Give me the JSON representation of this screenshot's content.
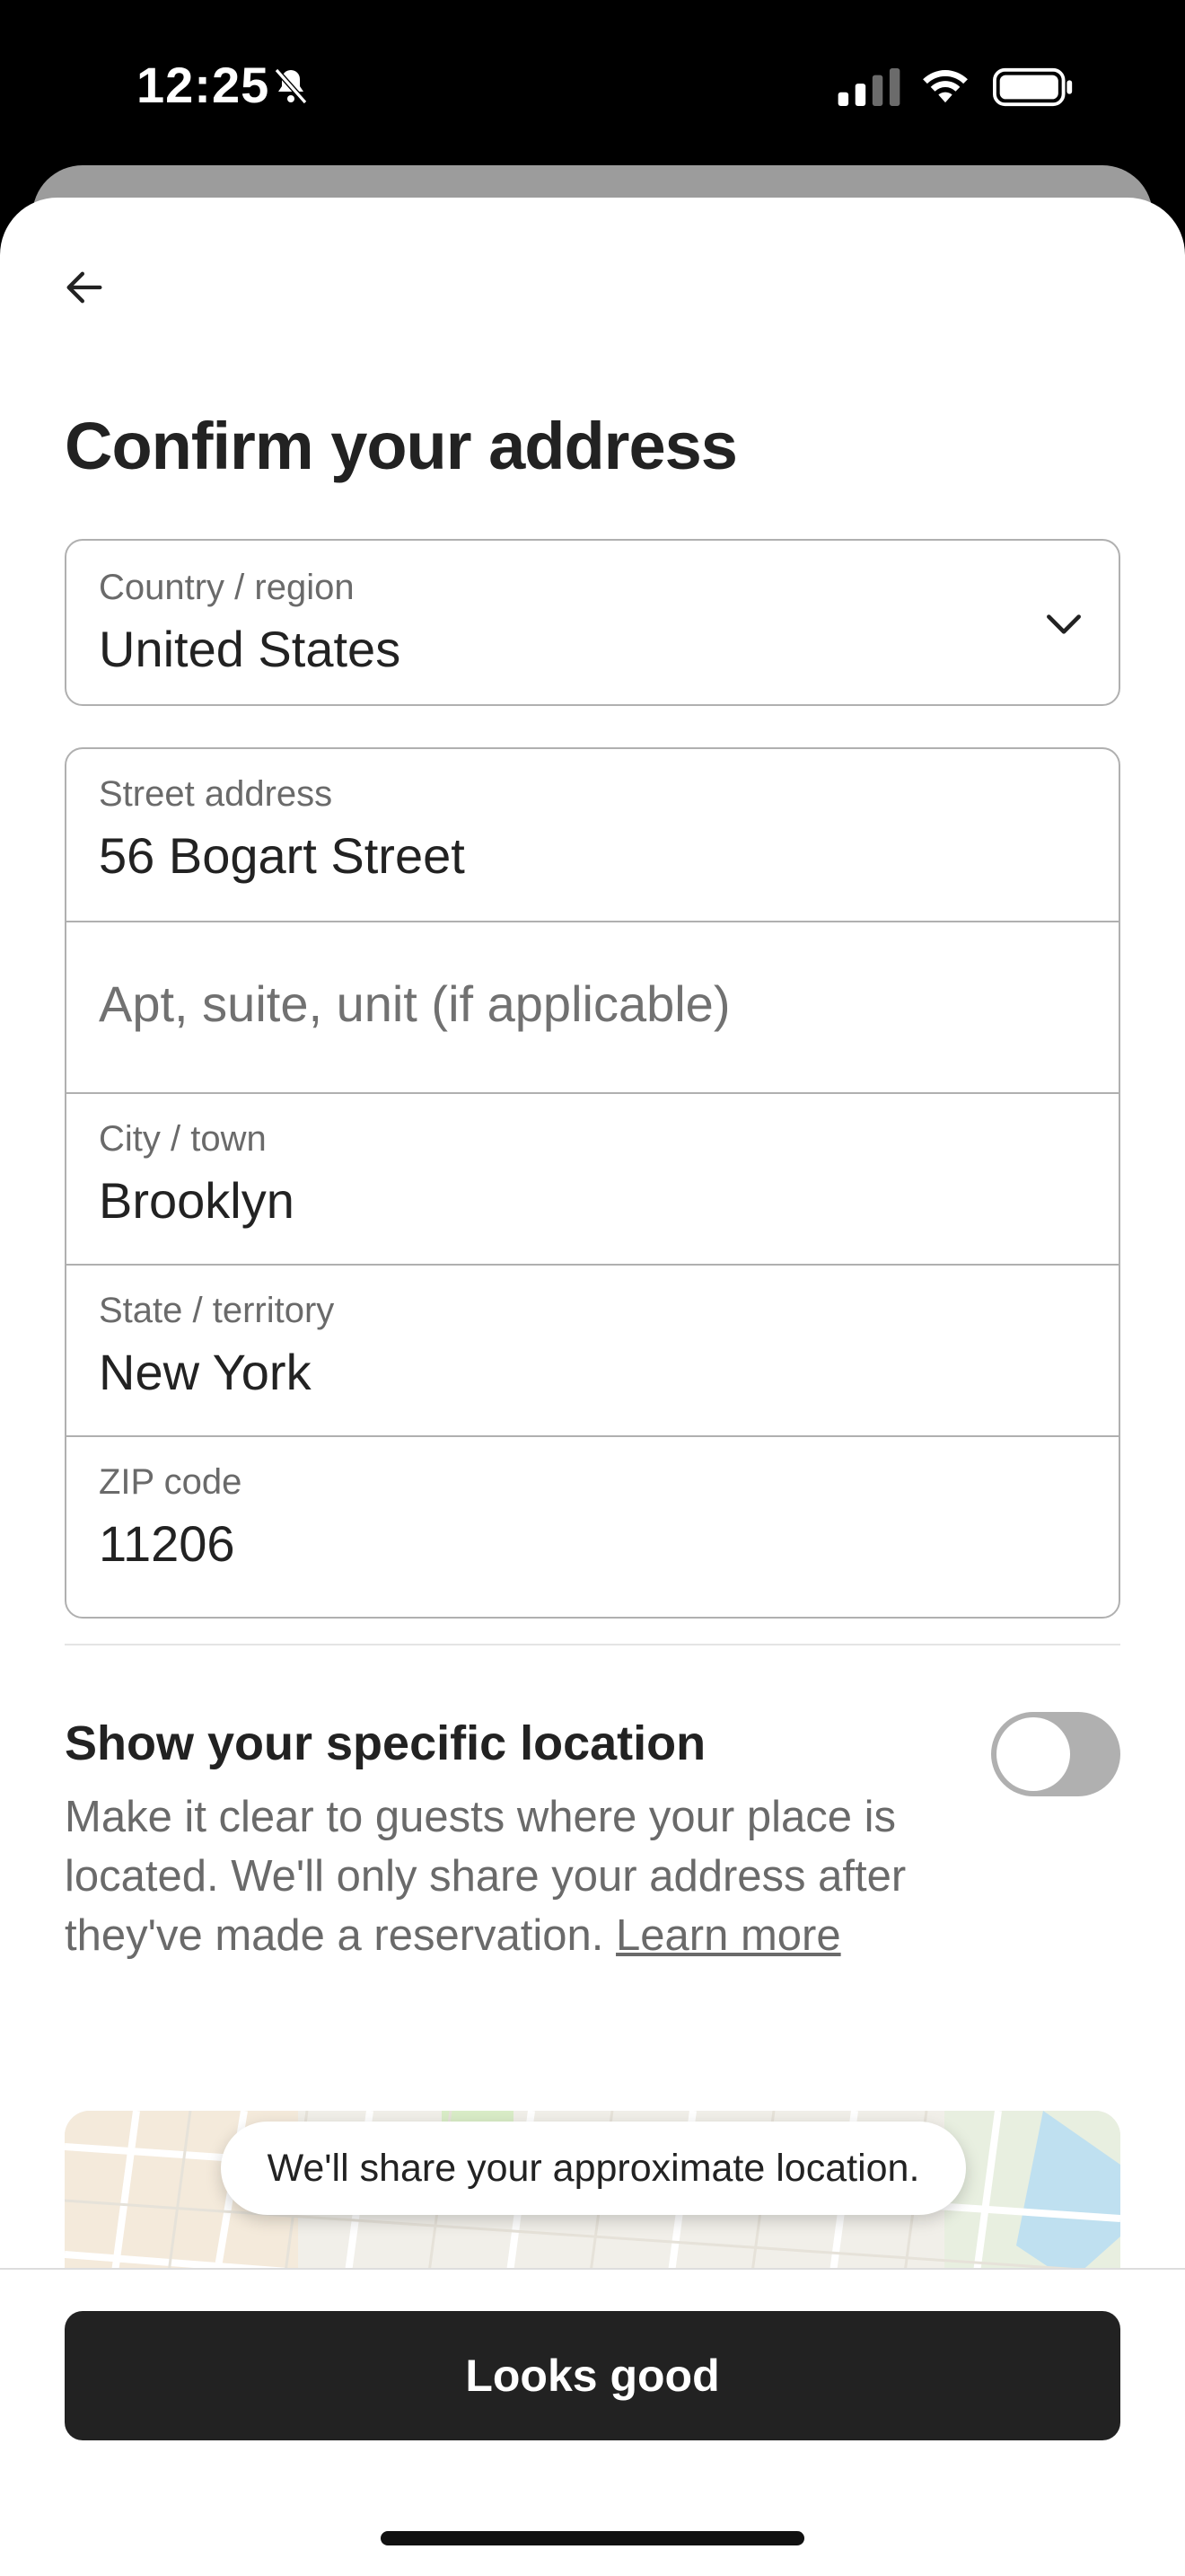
{
  "status_bar": {
    "time": "12:25",
    "icons": [
      "bell-slash-icon",
      "cellular-signal-icon",
      "wifi-icon",
      "battery-icon"
    ]
  },
  "header": {
    "back_icon": "arrow-left-icon",
    "title": "Confirm your address"
  },
  "form": {
    "country": {
      "label": "Country / region",
      "value": "United States",
      "icon": "chevron-down-icon"
    },
    "street": {
      "label": "Street address",
      "value": "56 Bogart Street"
    },
    "apt": {
      "placeholder": "Apt, suite, unit (if applicable)",
      "value": ""
    },
    "city": {
      "label": "City / town",
      "value": "Brooklyn"
    },
    "state": {
      "label": "State / territory",
      "value": "New York"
    },
    "zip": {
      "label": "ZIP code",
      "value": "11206"
    }
  },
  "location": {
    "title": "Show your specific location",
    "description": "Make it clear to guests where your place is located. We'll only share your address after they've made a reservation.",
    "learn_more": "Learn more",
    "toggle_on": false
  },
  "map": {
    "tooltip": "We'll share your approximate location."
  },
  "footer": {
    "button_label": "Looks good"
  },
  "colors": {
    "text_primary": "#222222",
    "text_secondary": "#6A6A6A",
    "border": "#B0B0B0",
    "button_bg": "#222222",
    "toggle_off": "#B0B0B0"
  }
}
